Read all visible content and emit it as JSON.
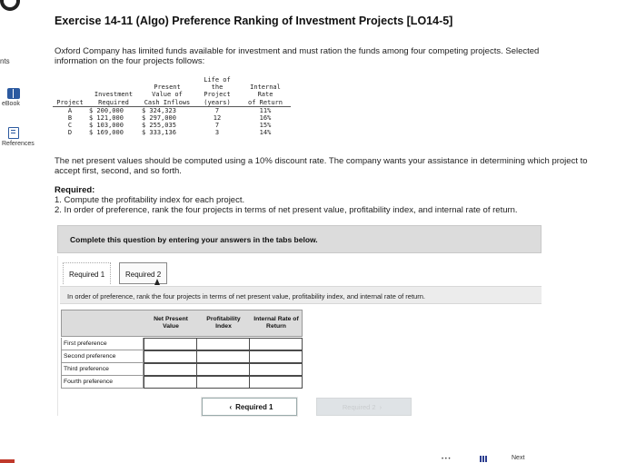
{
  "rail": {
    "pts_label": "nts",
    "ebook_label": "eBook",
    "references_label": "References"
  },
  "title": "Exercise 14-11 (Algo) Preference Ranking of Investment Projects [LO14-5]",
  "intro": "Oxford Company has limited funds available for investment and must ration the funds among four competing projects. Selected information on the four projects follows:",
  "projects_table": {
    "headers": {
      "project": "Project",
      "investment": [
        "Investment",
        "Required"
      ],
      "pv": [
        "Present",
        "Value of",
        "Cash Inflows"
      ],
      "life": [
        "Life of",
        "the",
        "Project",
        "(years)"
      ],
      "irr": [
        "Internal",
        "Rate",
        "of Return"
      ]
    },
    "rows": [
      {
        "project": "A",
        "investment": "$ 200,000",
        "pv": "$ 324,323",
        "life": "7",
        "irr": "11%"
      },
      {
        "project": "B",
        "investment": "$ 121,000",
        "pv": "$ 297,000",
        "life": "12",
        "irr": "16%"
      },
      {
        "project": "C",
        "investment": "$ 103,000",
        "pv": "$ 255,035",
        "life": "7",
        "irr": "15%"
      },
      {
        "project": "D",
        "investment": "$ 169,000",
        "pv": "$ 333,136",
        "life": "3",
        "irr": "14%"
      }
    ]
  },
  "npv_text": "The net present values should be computed using a 10% discount rate. The company wants your assistance in determining which project to accept first, second, and so forth.",
  "required": {
    "heading": "Required:",
    "line1": "1. Compute the profitability index for each project.",
    "line2": "2. In order of preference, rank the four projects in terms of net present value, profitability index, and internal rate of return."
  },
  "complete_banner": "Complete this question by entering your answers in the tabs below.",
  "tabs": [
    "Required 1",
    "Required 2"
  ],
  "instruction": "In order of preference, rank the four projects in terms of net present value, profitability index, and internal rate of return.",
  "answer_grid": {
    "columns": [
      "Net Present Value",
      "Profitability Index",
      "Internal Rate of Return"
    ],
    "rows": [
      "First preference",
      "Second preference",
      "Third preference",
      "Fourth preference"
    ]
  },
  "nav": {
    "prev": "Required 1",
    "next": "Required 2"
  },
  "bottom": {
    "next_label": "Next"
  }
}
